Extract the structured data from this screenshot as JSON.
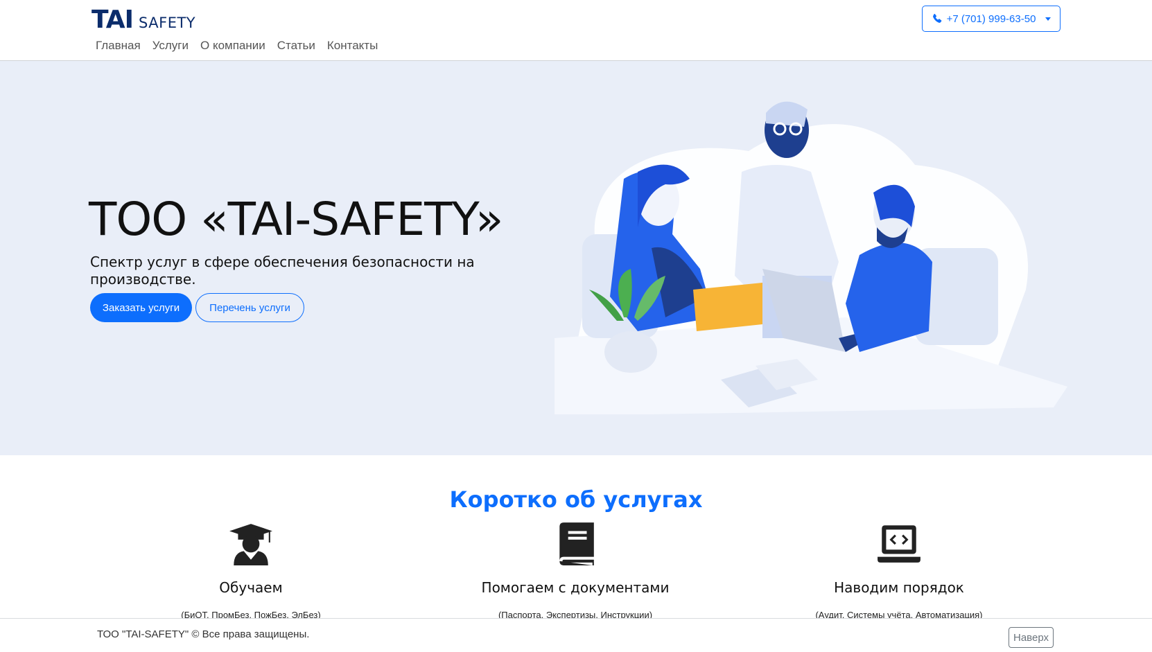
{
  "header": {
    "logo_main": "TAI",
    "logo_sub": "SAFETY",
    "nav": [
      "Главная",
      "Услуги",
      "О компании",
      "Статьи",
      "Контакты"
    ],
    "phone": "+7 (701) 999-63-50"
  },
  "hero": {
    "title": "ТОО «TAI-SAFETY»",
    "subtitle": "Спектр услуг в сфере обеспечения безопасности на производстве.",
    "btn_order": "Заказать услуги",
    "btn_list": "Перечень услуги"
  },
  "services": {
    "title": "Коротко об услугах",
    "items": [
      {
        "icon": "graduate-icon",
        "title": "Обучаем",
        "desc": "(БиОТ, ПромБез, ПожБез, ЭлБез)"
      },
      {
        "icon": "book-icon",
        "title": "Помогаем с документами",
        "desc": "(Паспорта, Экспертизы, Инструкции)"
      },
      {
        "icon": "laptop-code-icon",
        "title": "Наводим порядок",
        "desc": "(Аудит, Системы учёта, Автоматизация)"
      }
    ]
  },
  "footer": {
    "copyright": "ТОО \"TAI-SAFETY\" © Все права защищены.",
    "up": "Наверх"
  },
  "colors": {
    "accent": "#0d6efd",
    "hero_bg": "#e9eef8",
    "logo": "#0b2c6b"
  }
}
